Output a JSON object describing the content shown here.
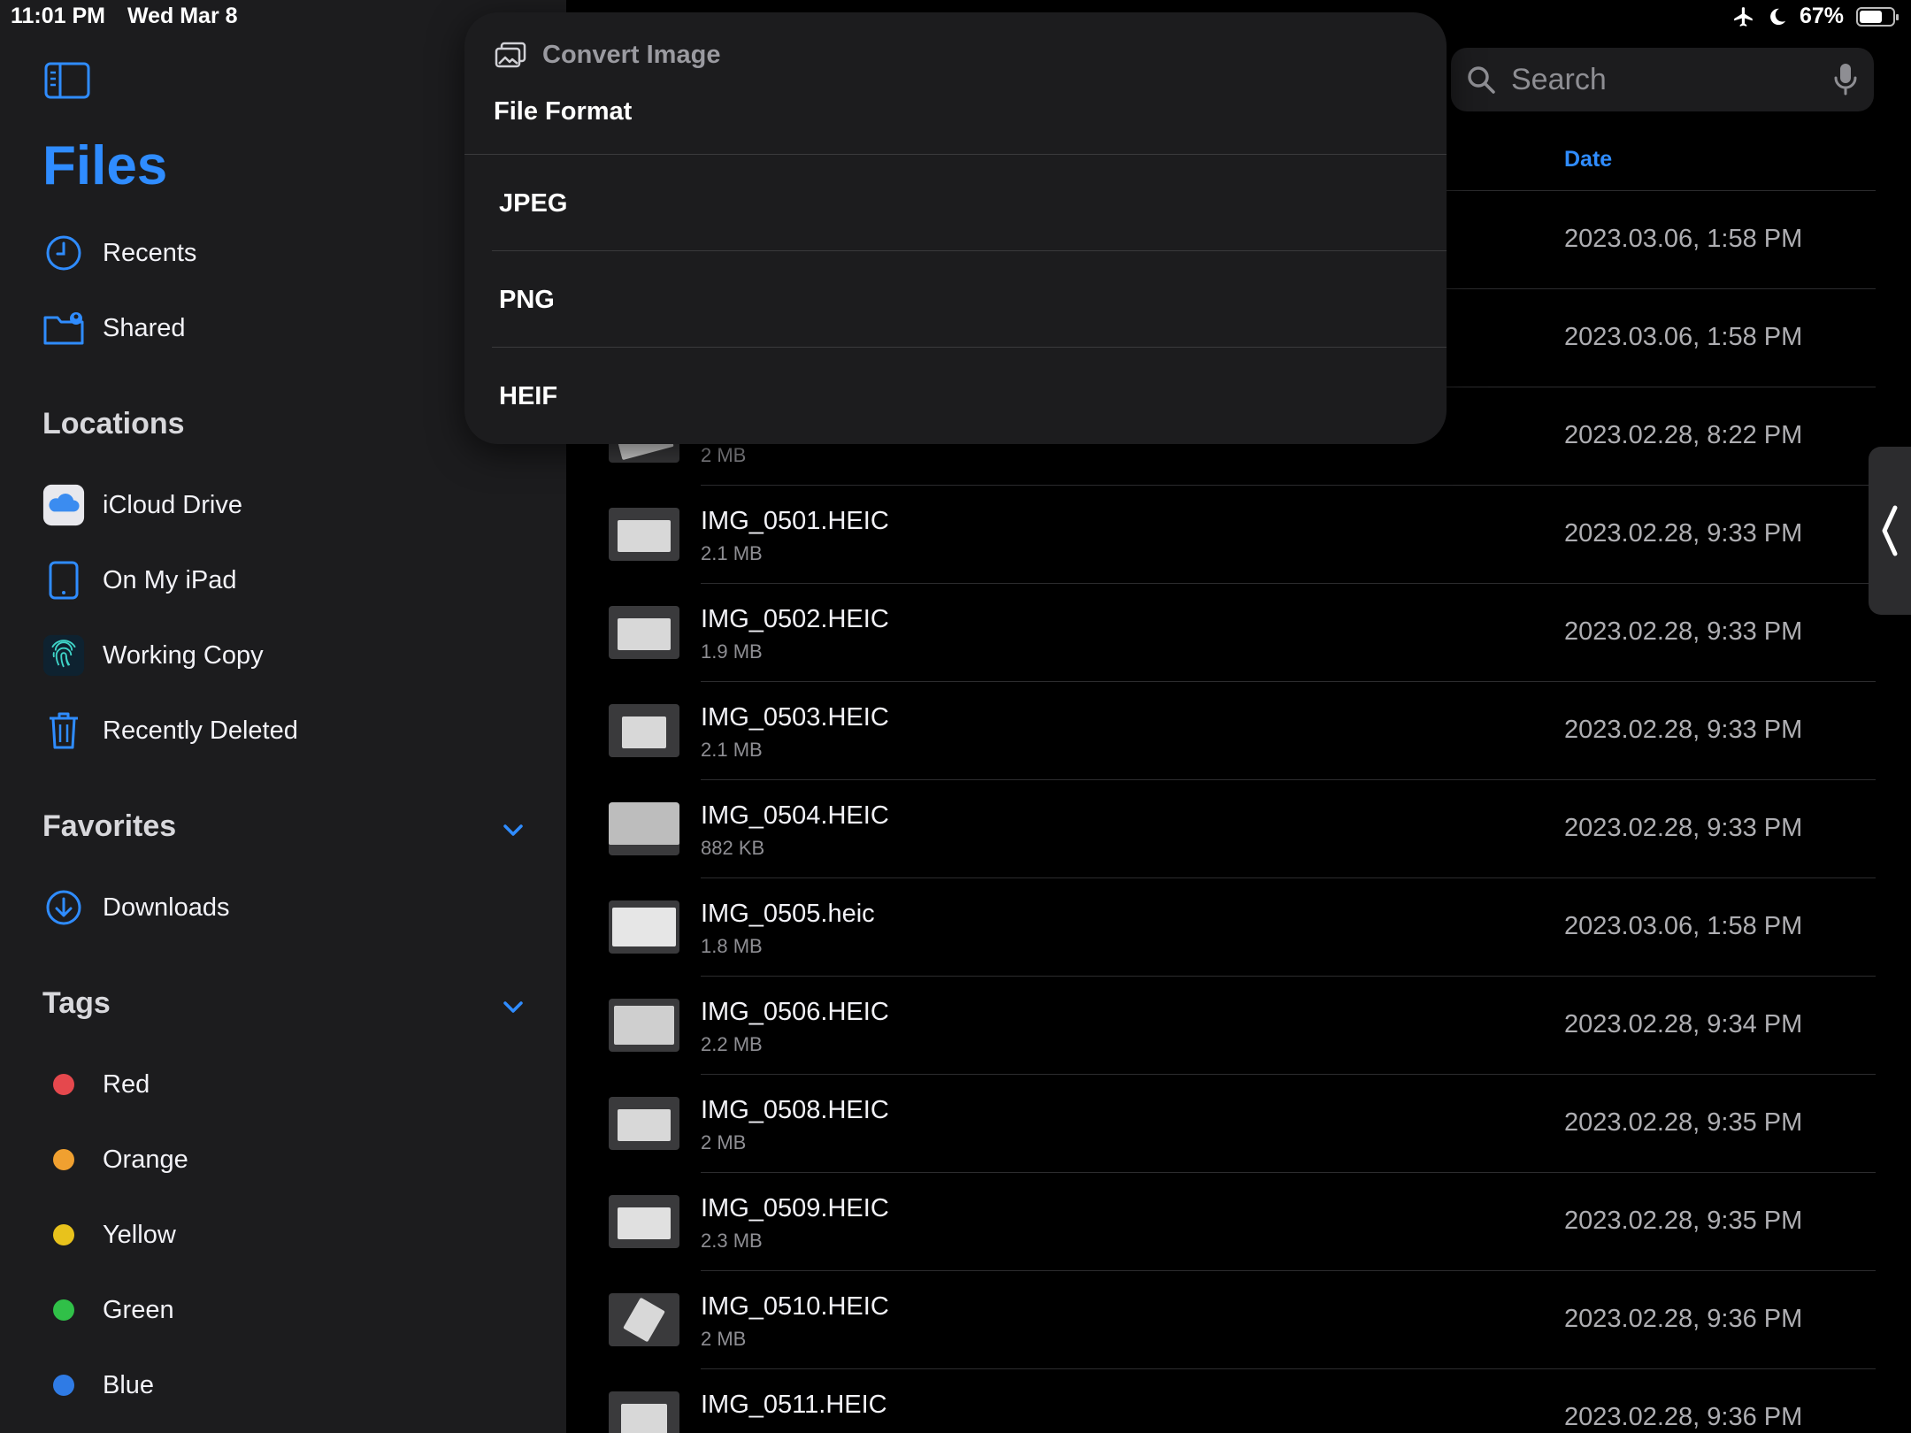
{
  "status_bar": {
    "time": "11:01 PM",
    "date": "Wed Mar 8",
    "battery": "67%",
    "battery_level": 0.67
  },
  "sidebar": {
    "title": "Files",
    "top_items": [
      {
        "label": "Recents",
        "icon": "clock-icon"
      },
      {
        "label": "Shared",
        "icon": "shared-folder-icon"
      }
    ],
    "locations_header": "Locations",
    "locations": [
      {
        "label": "iCloud Drive",
        "icon": "icloud-icon"
      },
      {
        "label": "On My iPad",
        "icon": "ipad-icon"
      },
      {
        "label": "Working Copy",
        "icon": "fingerprint-icon"
      },
      {
        "label": "Recently Deleted",
        "icon": "trash-icon"
      }
    ],
    "favorites_header": "Favorites",
    "favorites": [
      {
        "label": "Downloads",
        "icon": "download-icon"
      }
    ],
    "tags_header": "Tags",
    "tags": [
      {
        "label": "Red",
        "color": "#e5484d"
      },
      {
        "label": "Orange",
        "color": "#f0a030"
      },
      {
        "label": "Yellow",
        "color": "#e8c21c"
      },
      {
        "label": "Green",
        "color": "#30c048"
      },
      {
        "label": "Blue",
        "color": "#2f7be5"
      }
    ]
  },
  "search": {
    "placeholder": "Search"
  },
  "list": {
    "date_column": "Date",
    "rows": [
      {
        "name": "",
        "size": "",
        "date": "2023.03.06, 1:58 PM"
      },
      {
        "name": "",
        "size": "",
        "date": "2023.03.06, 1:58 PM"
      },
      {
        "name": "",
        "size": "2 MB",
        "date": "2023.02.28, 8:22 PM"
      },
      {
        "name": "IMG_0501.HEIC",
        "size": "2.1 MB",
        "date": "2023.02.28, 9:33 PM"
      },
      {
        "name": "IMG_0502.HEIC",
        "size": "1.9 MB",
        "date": "2023.02.28, 9:33 PM"
      },
      {
        "name": "IMG_0503.HEIC",
        "size": "2.1 MB",
        "date": "2023.02.28, 9:33 PM"
      },
      {
        "name": "IMG_0504.HEIC",
        "size": "882 KB",
        "date": "2023.02.28, 9:33 PM"
      },
      {
        "name": "IMG_0505.heic",
        "size": "1.8 MB",
        "date": "2023.03.06, 1:58 PM"
      },
      {
        "name": "IMG_0506.HEIC",
        "size": "2.2 MB",
        "date": "2023.02.28, 9:34 PM"
      },
      {
        "name": "IMG_0508.HEIC",
        "size": "2 MB",
        "date": "2023.02.28, 9:35 PM"
      },
      {
        "name": "IMG_0509.HEIC",
        "size": "2.3 MB",
        "date": "2023.02.28, 9:35 PM"
      },
      {
        "name": "IMG_0510.HEIC",
        "size": "2 MB",
        "date": "2023.02.28, 9:36 PM"
      },
      {
        "name": "IMG_0511.HEIC",
        "size": "",
        "date": "2023.02.28, 9:36 PM"
      }
    ]
  },
  "popover": {
    "title": "Convert Image",
    "subtitle": "File Format",
    "options": [
      "JPEG",
      "PNG",
      "HEIF"
    ]
  },
  "colors": {
    "accent": "#2f8cff",
    "sidebar_bg": "#1c1c1e",
    "background": "#000000"
  }
}
